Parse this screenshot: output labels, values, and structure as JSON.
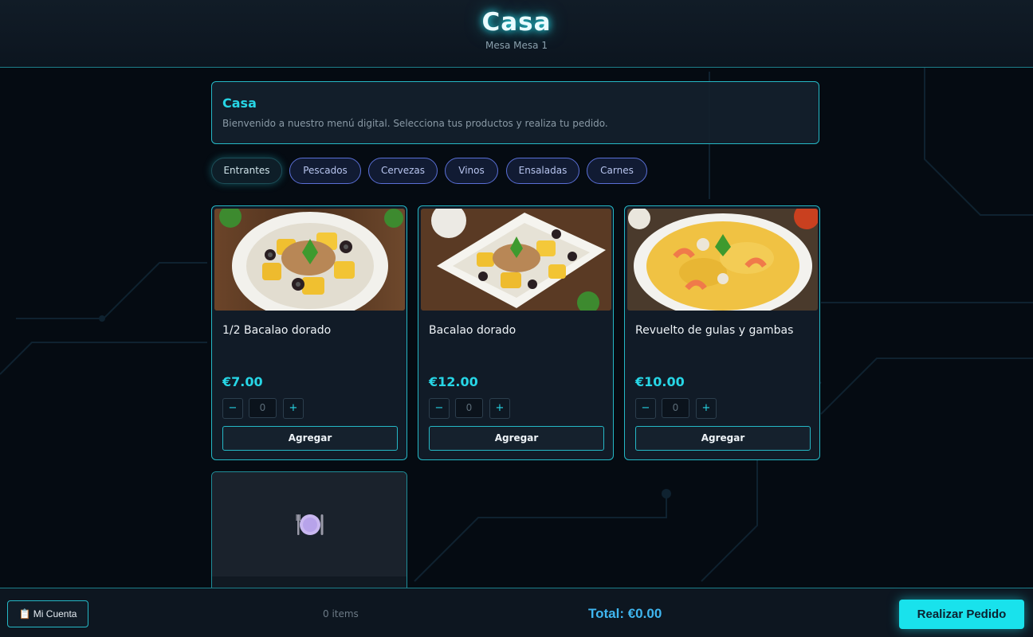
{
  "header": {
    "title": "Casa",
    "subtitle": "Mesa Mesa 1"
  },
  "welcome": {
    "title": "Casa",
    "message": "Bienvenido a nuestro menú digital. Selecciona tus productos y realiza tu pedido."
  },
  "categories": [
    {
      "label": "Entrantes",
      "active": true
    },
    {
      "label": "Pescados",
      "active": false
    },
    {
      "label": "Cervezas",
      "active": false
    },
    {
      "label": "Vinos",
      "active": false
    },
    {
      "label": "Ensaladas",
      "active": false
    },
    {
      "label": "Carnes",
      "active": false
    }
  ],
  "products": [
    {
      "name": "1/2 Bacalao dorado",
      "price": "€7.00",
      "qty": "0",
      "minus": "−",
      "plus": "+",
      "add_label": "Agregar"
    },
    {
      "name": "Bacalao dorado",
      "price": "€12.00",
      "qty": "0",
      "minus": "−",
      "plus": "+",
      "add_label": "Agregar"
    },
    {
      "name": "Revuelto de gulas y gambas",
      "price": "€10.00",
      "qty": "0",
      "minus": "−",
      "plus": "+",
      "add_label": "Agregar"
    }
  ],
  "placeholder_icon": "plate-cutlery-icon",
  "footer": {
    "account_label": "📋 Mi Cuenta",
    "items_label": "0 items",
    "total_label": "Total: €0.00",
    "order_label": "Realizar Pedido"
  },
  "colors": {
    "accent": "#27d6e6",
    "category_border": "#5a6fd6",
    "order_button": "#19e2ec",
    "total_text": "#3fb6f0",
    "background": "#050b12"
  }
}
